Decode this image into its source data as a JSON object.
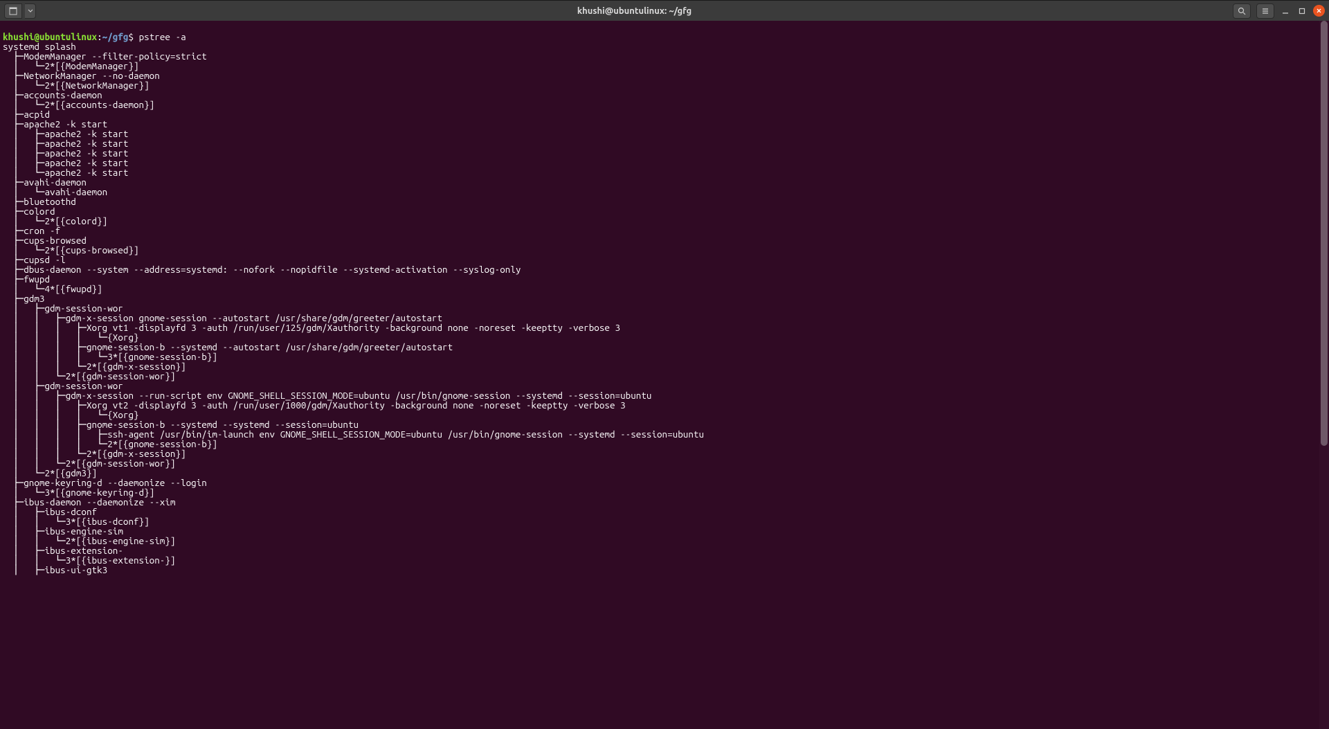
{
  "titlebar": {
    "title": "khushi@ubuntulinux: ~/gfg"
  },
  "prompt": {
    "user": "khushi@ubuntulinux",
    "colon": ":",
    "path": "~/gfg",
    "dollar": "$",
    "command": " pstree -a"
  },
  "lines": [
    "systemd splash",
    "  ├─ModemManager --filter-policy=strict",
    "  │   └─2*[{ModemManager}]",
    "  ├─NetworkManager --no-daemon",
    "  │   └─2*[{NetworkManager}]",
    "  ├─accounts-daemon",
    "  │   └─2*[{accounts-daemon}]",
    "  ├─acpid",
    "  ├─apache2 -k start",
    "  │   ├─apache2 -k start",
    "  │   ├─apache2 -k start",
    "  │   ├─apache2 -k start",
    "  │   ├─apache2 -k start",
    "  │   └─apache2 -k start",
    "  ├─avahi-daemon",
    "  │   └─avahi-daemon",
    "  ├─bluetoothd",
    "  ├─colord",
    "  │   └─2*[{colord}]",
    "  ├─cron -f",
    "  ├─cups-browsed",
    "  │   └─2*[{cups-browsed}]",
    "  ├─cupsd -l",
    "  ├─dbus-daemon --system --address=systemd: --nofork --nopidfile --systemd-activation --syslog-only",
    "  ├─fwupd",
    "  │   └─4*[{fwupd}]",
    "  ├─gdm3",
    "  │   ├─gdm-session-wor",
    "  │   │   ├─gdm-x-session gnome-session --autostart /usr/share/gdm/greeter/autostart",
    "  │   │   │   ├─Xorg vt1 -displayfd 3 -auth /run/user/125/gdm/Xauthority -background none -noreset -keeptty -verbose 3",
    "  │   │   │   │   └─{Xorg}",
    "  │   │   │   ├─gnome-session-b --systemd --autostart /usr/share/gdm/greeter/autostart",
    "  │   │   │   │   └─3*[{gnome-session-b}]",
    "  │   │   │   └─2*[{gdm-x-session}]",
    "  │   │   └─2*[{gdm-session-wor}]",
    "  │   ├─gdm-session-wor",
    "  │   │   ├─gdm-x-session --run-script env GNOME_SHELL_SESSION_MODE=ubuntu /usr/bin/gnome-session --systemd --session=ubuntu",
    "  │   │   │   ├─Xorg vt2 -displayfd 3 -auth /run/user/1000/gdm/Xauthority -background none -noreset -keeptty -verbose 3",
    "  │   │   │   │   └─{Xorg}",
    "  │   │   │   ├─gnome-session-b --systemd --systemd --session=ubuntu",
    "  │   │   │   │   ├─ssh-agent /usr/bin/im-launch env GNOME_SHELL_SESSION_MODE=ubuntu /usr/bin/gnome-session --systemd --session=ubuntu",
    "  │   │   │   │   └─2*[{gnome-session-b}]",
    "  │   │   │   └─2*[{gdm-x-session}]",
    "  │   │   └─2*[{gdm-session-wor}]",
    "  │   └─2*[{gdm3}]",
    "  ├─gnome-keyring-d --daemonize --login",
    "  │   └─3*[{gnome-keyring-d}]",
    "  ├─ibus-daemon --daemonize --xim",
    "  │   ├─ibus-dconf",
    "  │   │   └─3*[{ibus-dconf}]",
    "  │   ├─ibus-engine-sim",
    "  │   │   └─2*[{ibus-engine-sim}]",
    "  │   ├─ibus-extension-",
    "  │   │   └─3*[{ibus-extension-}]",
    "  │   ├─ibus-ui-gtk3"
  ]
}
